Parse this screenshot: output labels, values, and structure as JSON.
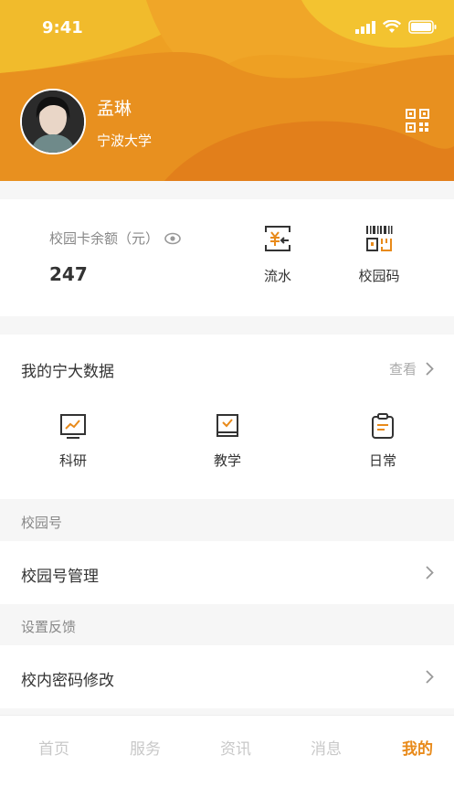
{
  "status_bar": {
    "time": "9:41"
  },
  "profile": {
    "name": "孟琳",
    "school": "宁波大学"
  },
  "card": {
    "balance_label": "校园卡余额（元）",
    "balance_value": "247",
    "actions": [
      {
        "label": "流水",
        "icon": "yuan-transfer-icon"
      },
      {
        "label": "校园码",
        "icon": "barcode-icon"
      }
    ]
  },
  "data_section": {
    "title": "我的宁大数据",
    "view_more": "查看",
    "categories": [
      {
        "label": "科研",
        "icon": "chart-monitor-icon"
      },
      {
        "label": "教学",
        "icon": "check-book-icon"
      },
      {
        "label": "日常",
        "icon": "clipboard-icon"
      }
    ]
  },
  "campus_section": {
    "label": "校园号",
    "item": "校园号管理"
  },
  "settings_section": {
    "label": "设置反馈",
    "item": "校内密码修改"
  },
  "tabs": [
    "首页",
    "服务",
    "资讯",
    "消息",
    "我的"
  ],
  "colors": {
    "accent": "#e88a1a",
    "header_light": "#f2b72e",
    "header_dark": "#e07d1a"
  }
}
